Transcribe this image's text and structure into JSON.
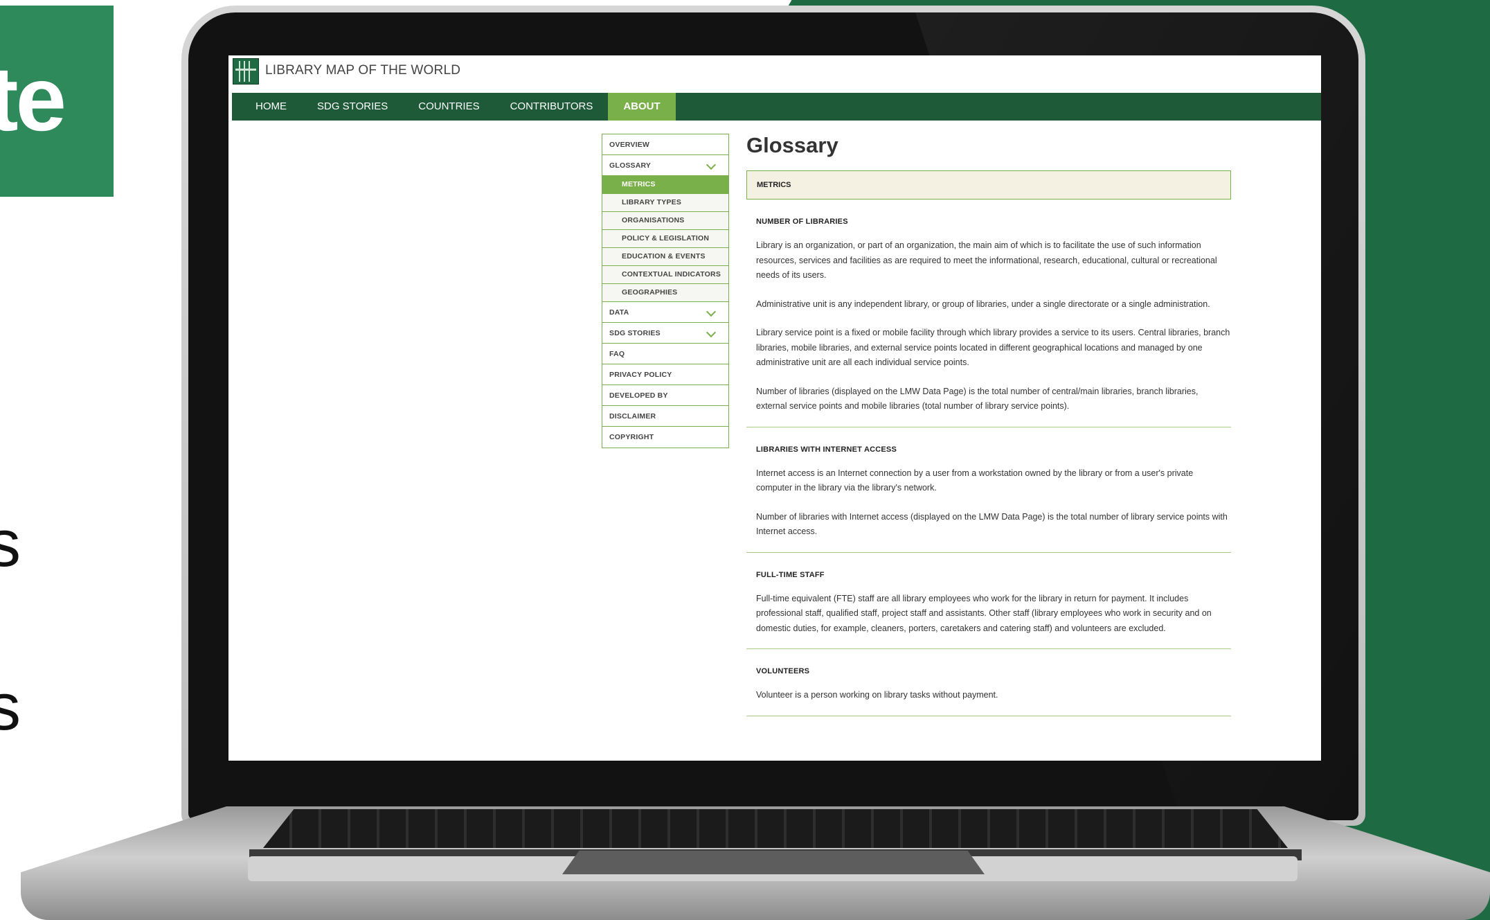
{
  "backdrop": {
    "tile_text": "te",
    "side_letters": [
      "s",
      "s"
    ]
  },
  "site": {
    "title": "LIBRARY MAP OF THE WORLD"
  },
  "nav": [
    "HOME",
    "SDG STORIES",
    "COUNTRIES",
    "CONTRIBUTORS",
    "ABOUT"
  ],
  "sidebar": {
    "overview": "OVERVIEW",
    "glossary": "GLOSSARY",
    "glossary_items": [
      "METRICS",
      "LIBRARY TYPES",
      "ORGANISATIONS",
      "POLICY & LEGISLATION",
      "EDUCATION & EVENTS",
      "CONTEXTUAL INDICATORS",
      "GEOGRAPHIES"
    ],
    "data": "DATA",
    "sdg": "SDG STORIES",
    "faq": "FAQ",
    "privacy": "PRIVACY POLICY",
    "developed": "DEVELOPED BY",
    "disclaimer": "DISCLAIMER",
    "copyright": "COPYRIGHT"
  },
  "main": {
    "title": "Glossary",
    "metrics_label": "METRICS",
    "sections": [
      {
        "heading": "NUMBER OF LIBRARIES",
        "paras": [
          "Library is an organization, or part of an organization, the main aim of which is to facilitate the use of such information resources, services and facilities as are required to meet the informational, research, educational, cultural or recreational needs of its users.",
          "Administrative unit is any independent library, or group of libraries, under a single directorate or a single administration.",
          "Library service point is a fixed or mobile facility through which library provides a service to its users. Central libraries, branch libraries, mobile libraries, and external service points located in different geographical locations and managed by one administrative unit are all each individual service points.",
          "Number of libraries (displayed on the LMW Data Page) is the total number of central/main libraries, branch libraries, external service points and mobile libraries (total number of library service points)."
        ]
      },
      {
        "heading": "LIBRARIES WITH INTERNET ACCESS",
        "paras": [
          "Internet access is an Internet connection by a user from a workstation owned by the library or from a user's private computer in the library via the library's network.",
          "Number of libraries with Internet access (displayed on the LMW Data Page) is the total number of library service points with Internet access."
        ]
      },
      {
        "heading": "FULL-TIME STAFF",
        "paras": [
          "Full-time equivalent (FTE) staff are all library employees who work for the library in return for payment. It includes professional staff, qualified staff, project staff and assistants. Other staff (library employees who work in security and on domestic duties, for example, cleaners, porters, caretakers and catering staff) and volunteers are excluded."
        ]
      },
      {
        "heading": "VOLUNTEERS",
        "paras": [
          "Volunteer is a person working on library tasks without payment."
        ]
      }
    ]
  }
}
